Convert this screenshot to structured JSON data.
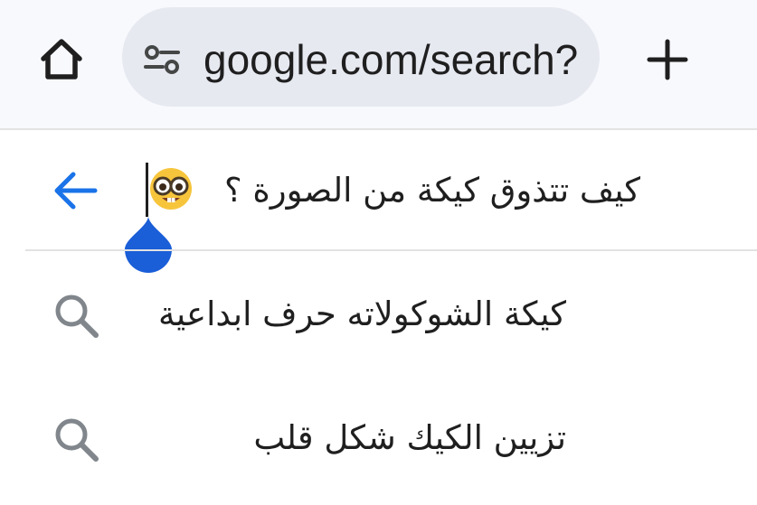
{
  "browser": {
    "url": "google.com/search?",
    "home_icon": "home-icon",
    "site_info_icon": "tune-icon",
    "new_tab_icon": "plus-icon"
  },
  "search": {
    "query": "كيف تتذوق كيكة من الصورة ؟",
    "back_icon": "arrow-back-icon",
    "emoji": "nerd-face-emoji",
    "accent_color": "#1a73e8",
    "handle_color": "#1a5ed8"
  },
  "suggestions": [
    {
      "text": "كيكة الشوكولاته حرف ابداعية",
      "icon": "search-icon"
    },
    {
      "text": "تزيين الكيك شكل قلب",
      "icon": "search-icon"
    }
  ]
}
